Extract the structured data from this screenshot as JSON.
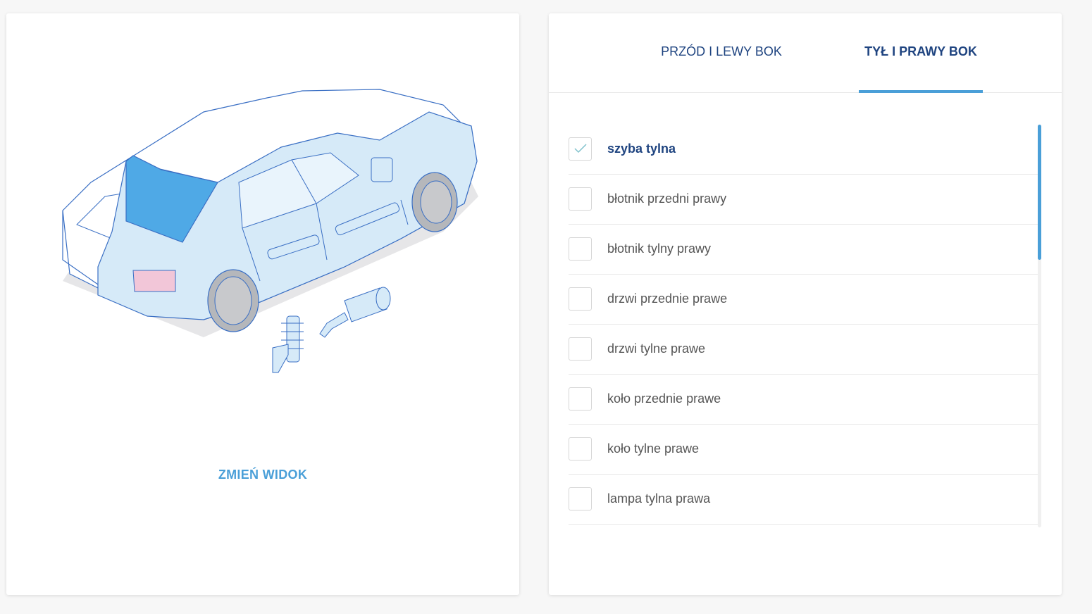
{
  "left_panel": {
    "change_view_label": "ZMIEŃ WIDOK"
  },
  "tabs": [
    {
      "label": "PRZÓD I LEWY BOK",
      "active": false
    },
    {
      "label": "TYŁ I PRAWY BOK",
      "active": true
    }
  ],
  "parts": [
    {
      "label": "szyba tylna",
      "checked": true
    },
    {
      "label": "błotnik przedni prawy",
      "checked": false
    },
    {
      "label": "błotnik tylny prawy",
      "checked": false
    },
    {
      "label": "drzwi przednie prawe",
      "checked": false
    },
    {
      "label": "drzwi tylne prawe",
      "checked": false
    },
    {
      "label": "koło przednie prawe",
      "checked": false
    },
    {
      "label": "koło tylne prawe",
      "checked": false
    },
    {
      "label": "lampa tylna prawa",
      "checked": false
    }
  ],
  "colors": {
    "accent": "#4a9fd8",
    "navy": "#1f4480",
    "car_fill": "#d6eaf8",
    "car_outline": "#3a6fc4",
    "highlight": "#4fa9e6",
    "tail_light": "#f2c6d8"
  },
  "icons": {
    "checkmark": "check-icon",
    "car": "car-illustration"
  }
}
